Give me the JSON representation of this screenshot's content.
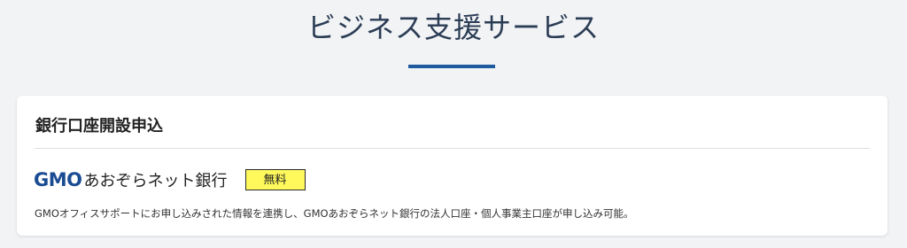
{
  "section": {
    "title": "ビジネス支援サービス"
  },
  "card": {
    "title": "銀行口座開設申込",
    "bank": {
      "logo_text": "GMO",
      "name": "あおぞらネット銀行"
    },
    "badge": "無料",
    "description": "GMOオフィスサポートにお申し込みされた情報を連携し、GMOあおぞらネット銀行の法人口座・個人事業主口座が申し込み可能。"
  },
  "colors": {
    "accent": "#1f5b9e",
    "badge_bg": "#fff95c",
    "logo": "#1a4c93"
  }
}
